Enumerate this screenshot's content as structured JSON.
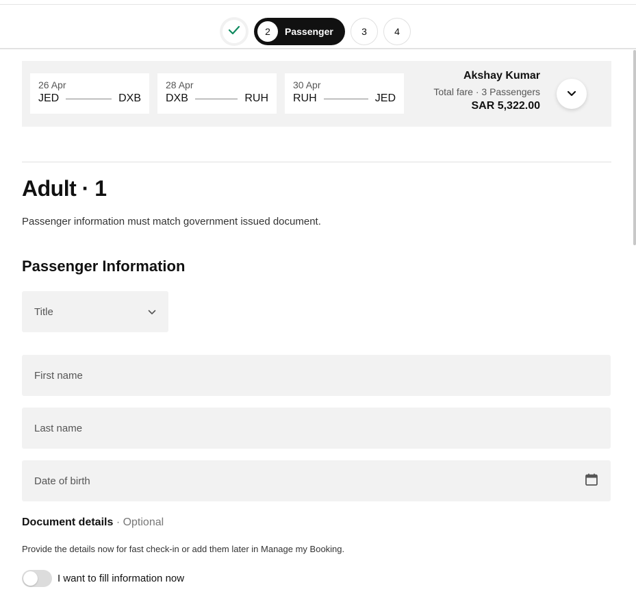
{
  "stepper": {
    "active_step": "2",
    "active_label": "Passenger",
    "steps_remaining": [
      "3",
      "4"
    ]
  },
  "summary": {
    "legs": [
      {
        "date": "26 Apr",
        "from": "JED",
        "to": "DXB"
      },
      {
        "date": "28 Apr",
        "from": "DXB",
        "to": "RUH"
      },
      {
        "date": "30 Apr",
        "from": "RUH",
        "to": "JED"
      }
    ],
    "passenger_name": "Akshay Kumar",
    "fare_label": "Total fare · 3 Passengers",
    "fare_amount": "SAR 5,322.00"
  },
  "main": {
    "heading": "Adult · 1",
    "subtitle": "Passenger information must match government issued document.",
    "section_title": "Passenger Information"
  },
  "form": {
    "title_placeholder": "Title",
    "first_name_placeholder": "First name",
    "last_name_placeholder": "Last name",
    "dob_placeholder": "Date of birth"
  },
  "document": {
    "title": "Document details",
    "optional": "· Optional",
    "description": "Provide the details now for fast check-in or add them later in Manage my Booking.",
    "toggle_label": "I want to fill information now",
    "toggle_on": false
  },
  "colors": {
    "accent": "#111111",
    "check": "#0f8a5f",
    "field_bg": "#f2f2f2"
  }
}
